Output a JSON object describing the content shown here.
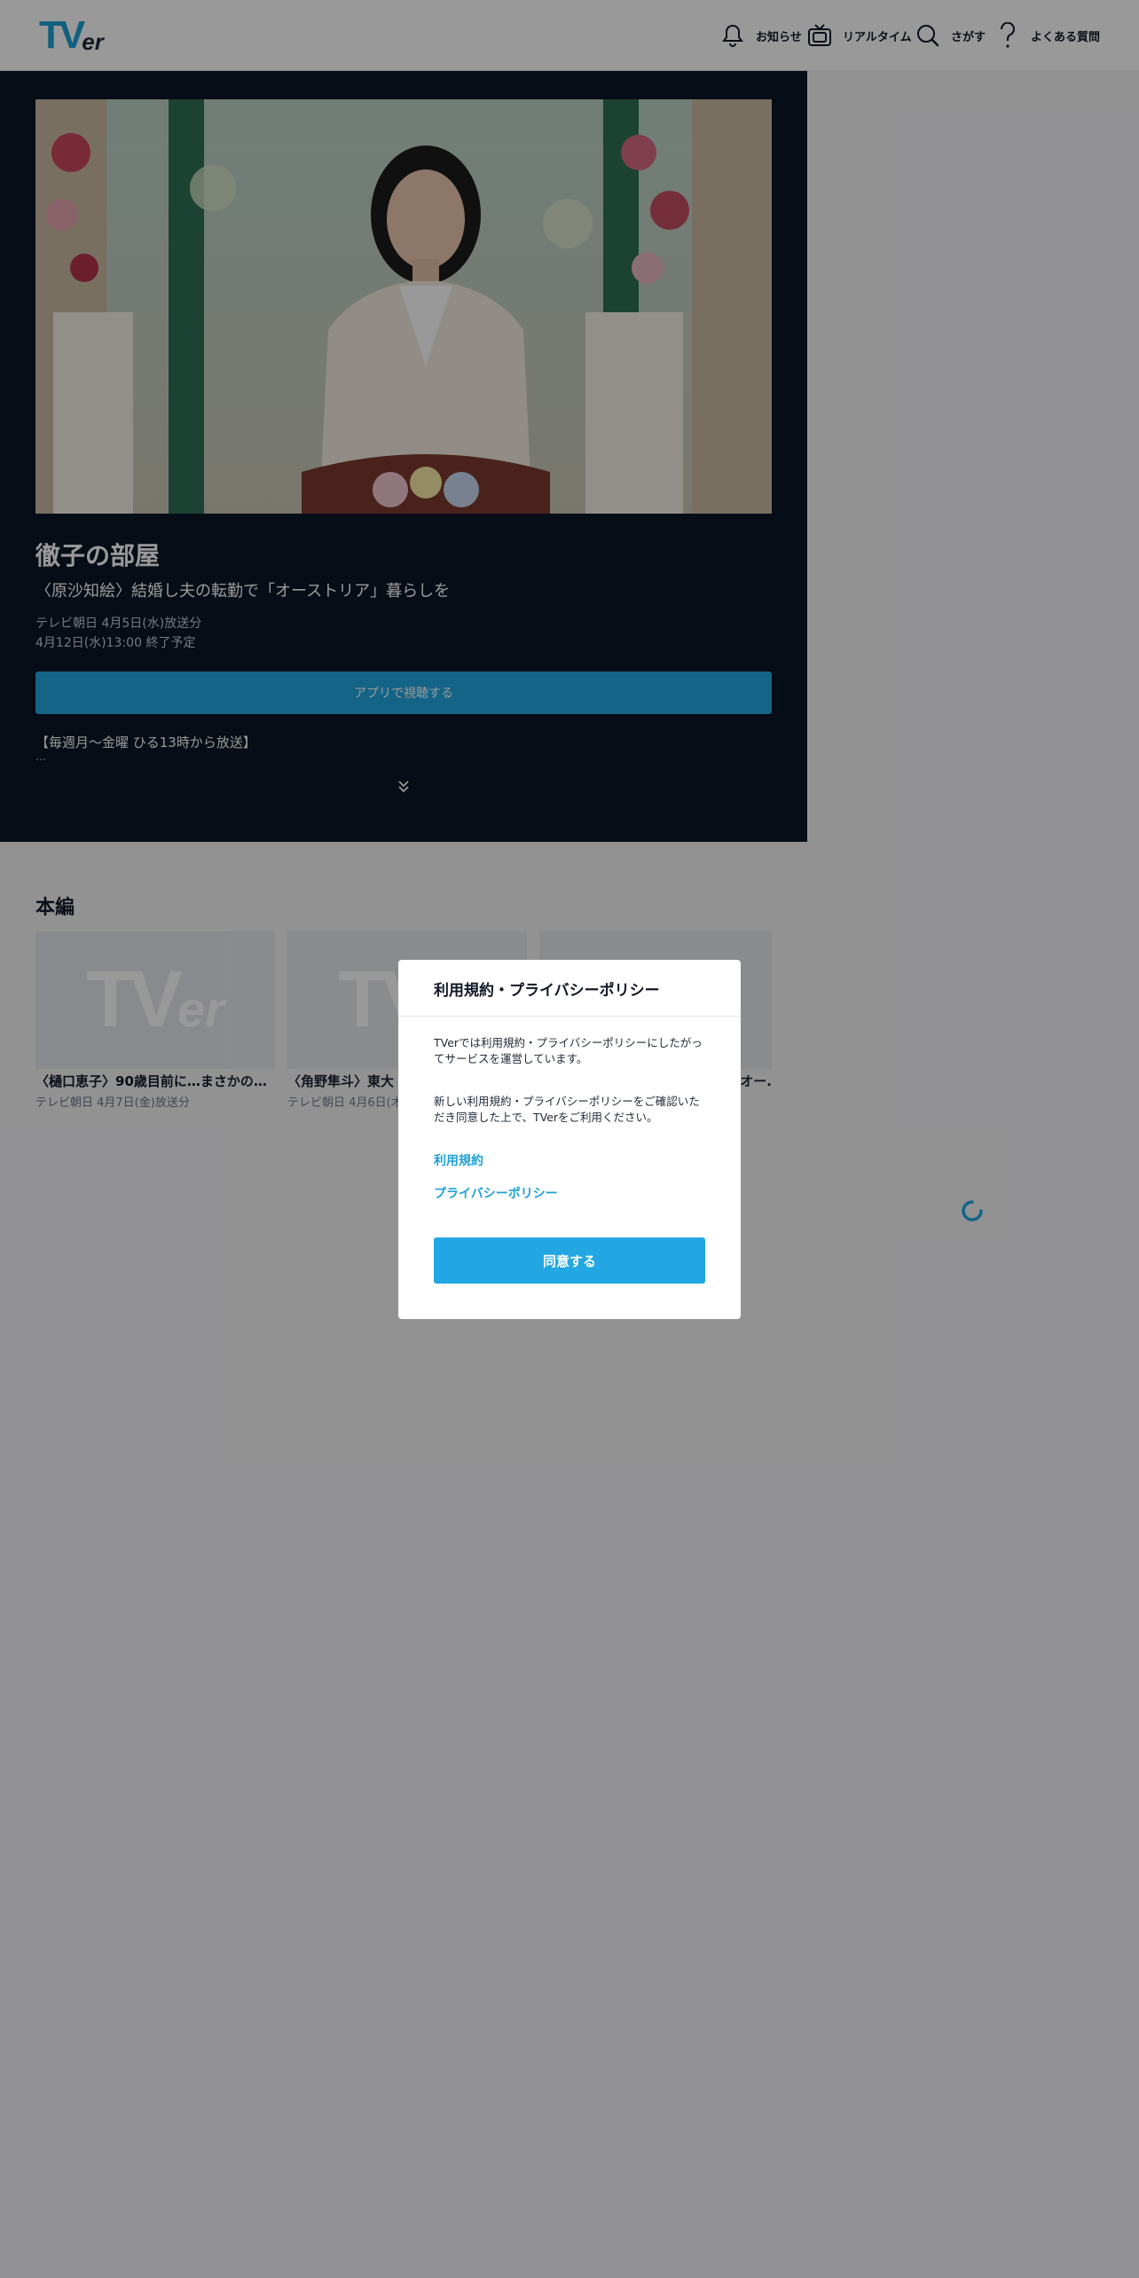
{
  "header": {
    "logo": {
      "t": "TV",
      "er": "er"
    },
    "nav": [
      {
        "label": "お知らせ",
        "icon": "bell-icon"
      },
      {
        "label": "リアルタイム",
        "icon": "tv-icon"
      },
      {
        "label": "さがす",
        "icon": "search-icon"
      },
      {
        "label": "よくある質問",
        "icon": "question-icon"
      }
    ]
  },
  "hero": {
    "title": "徹子の部屋",
    "subtitle": "〈原沙知絵〉結婚し夫の転勤で「オーストリア」暮らしを",
    "broadcast": "テレビ朝日 4月5日(水)放送分",
    "expiry": "4月12日(水)13:00 終了予定",
    "watch_button": "アプリで視聴する",
    "description": "【毎週月～金曜 ひる13時から放送】",
    "ellipsis": "…"
  },
  "section": {
    "title": "本編",
    "cards": [
      {
        "title": "〈樋口恵子〉90歳目前に…まさかの…",
        "meta": "テレビ朝日 4月7日(金)放送分"
      },
      {
        "title": "〈角野隼斗〉東大",
        "meta": "テレビ朝日 4月6日(木"
      },
      {
        "title": "オー.",
        "meta": ""
      }
    ]
  },
  "modal": {
    "title": "利用規約・プライバシーポリシー",
    "paragraph1": "TVerでは利用規約・プライバシーポリシーにしたがってサービスを運営しています。",
    "paragraph2": "新しい利用規約・プライバシーポリシーをご確認いただき同意した上で、TVerをご利用ください。",
    "terms_link": "利用規約",
    "privacy_link": "プライバシーポリシー",
    "agree_button": "同意する"
  },
  "colors": {
    "accent": "#22a7e3",
    "hero_bg": "#0b1626",
    "overlay": "rgba(0,0,0,0.4)"
  }
}
